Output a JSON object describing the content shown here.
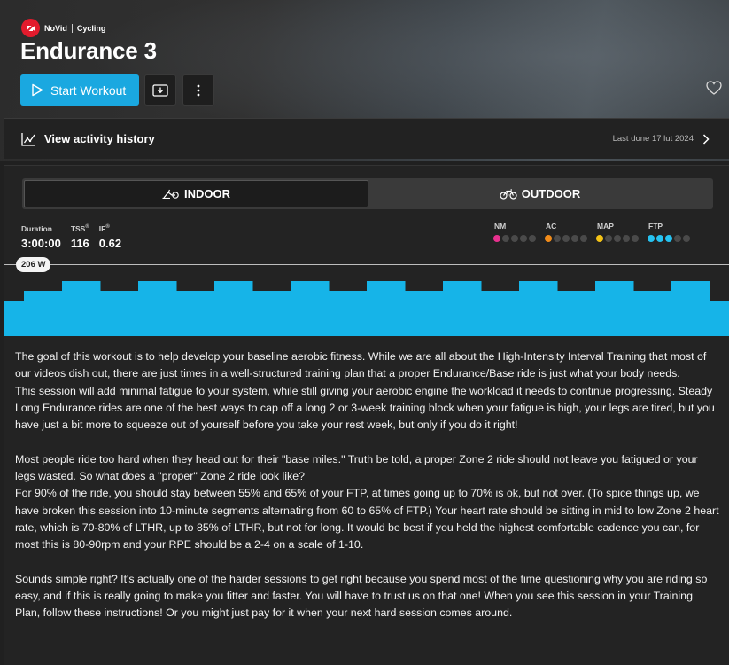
{
  "header": {
    "brand_name": "NoVid",
    "brand_category": "Cycling",
    "title": "Endurance 3",
    "start_label": "Start Workout"
  },
  "history": {
    "label": "View activity history",
    "last_done": "Last done 17 lut 2024"
  },
  "mode": {
    "indoor_label": "INDOOR",
    "outdoor_label": "OUTDOOR",
    "selected": "indoor"
  },
  "stats": {
    "duration_label": "Duration",
    "duration_value": "3:00:00",
    "tss_label": "TSS",
    "tss_value": "116",
    "if_label": "IF",
    "if_value": "0.62"
  },
  "zones": [
    {
      "label": "NM",
      "color": "#e8318f",
      "level": 1
    },
    {
      "label": "AC",
      "color": "#f28c1a",
      "level": 1
    },
    {
      "label": "MAP",
      "color": "#f4c316",
      "level": 1
    },
    {
      "label": "FTP",
      "color": "#26c2f0",
      "level": 3
    }
  ],
  "ftp_value": "206 W",
  "profile": {
    "color": "#16b4e8",
    "ftp_watts": 206,
    "segments_pct": [
      55,
      60,
      65,
      60,
      65,
      60,
      65,
      60,
      65,
      60,
      65,
      60,
      65,
      60,
      65,
      60,
      65,
      60,
      65,
      55
    ]
  },
  "description": "The goal of this workout is to help develop your baseline aerobic fitness. While we are all about the High-Intensity Interval Training that most of our videos dish out, there are just times in a well-structured training plan that a proper Endurance/Base ride is just what your body needs.\nThis session will add minimal fatigue to your system, while still giving your aerobic engine the workload it needs to continue progressing. Steady Long Endurance rides are one of the best ways to cap off a long 2 or 3-week training block when your fatigue is high, your legs are tired, but you have just a bit more to squeeze out of yourself before you take your rest week, but only if you do it right!\n\nMost people ride too hard when they head out for their \"base miles.\" Truth be told, a proper Zone 2 ride should not leave you fatigued or your legs wasted. So what does a \"proper\" Zone 2 ride look like?\nFor 90% of the ride, you should stay between 55% and 65% of your FTP, at times going up to 70% is ok, but not over. (To spice things up, we have broken this session into 10-minute segments alternating from 60 to 65% of FTP.) Your heart rate should be sitting in mid to low Zone 2 heart rate, which is 70-80% of LTHR, up to 85% of LTHR, but not for long. It would be best if you held the highest comfortable cadence you can, for most this is 80-90rpm and your RPE should be a 2-4 on a scale of 1-10.\n\nSounds simple right? It's actually one of the harder sessions to get right because you spend most of the time questioning why you are riding so easy, and if this is really going to make you fitter and faster. You will have to trust us on that one! When you see this session in your Training Plan, follow these instructions! Or you might just pay for it when your next hard session comes around."
}
